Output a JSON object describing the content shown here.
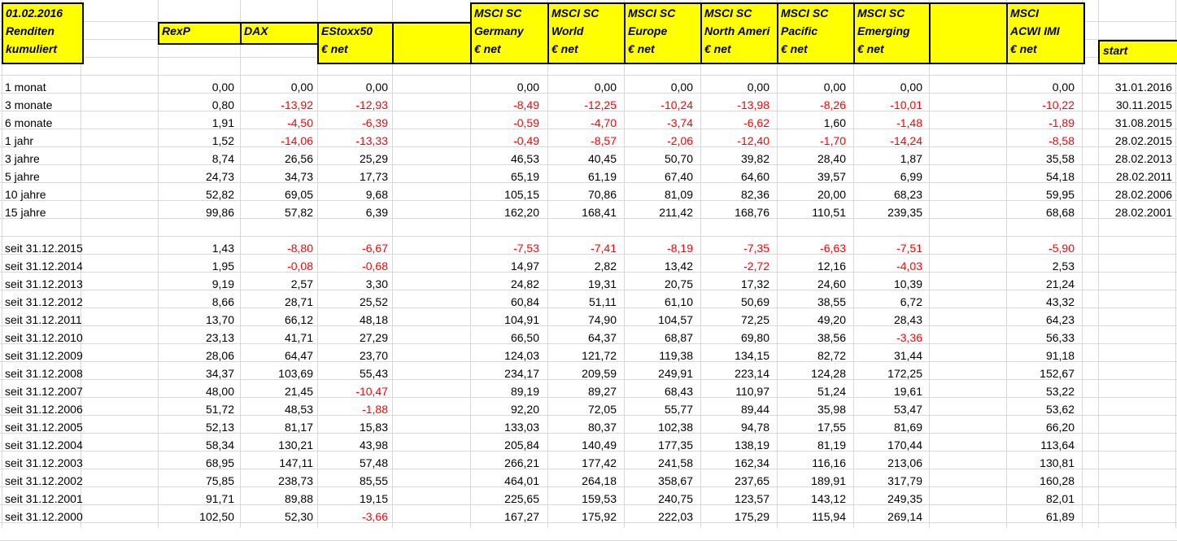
{
  "header": {
    "date": "01.02.2016",
    "renditen": "Renditen",
    "kumuliert": "kumuliert",
    "start_label": "start",
    "columns": [
      {
        "line1": "",
        "line2": "RexP",
        "line3": ""
      },
      {
        "line1": "",
        "line2": "DAX",
        "line3": ""
      },
      {
        "line1": "",
        "line2": "EStoxx50",
        "line3": "€ net"
      },
      {
        "line1": "",
        "line2": "",
        "line3": ""
      },
      {
        "line1": "MSCI SC",
        "line2": "Germany",
        "line3": "€ net"
      },
      {
        "line1": "MSCI SC",
        "line2": "World",
        "line3": "€ net"
      },
      {
        "line1": "MSCI SC",
        "line2": "Europe",
        "line3": "€ net"
      },
      {
        "line1": "MSCI SC",
        "line2": "North Ameri",
        "line3": "€ net"
      },
      {
        "line1": "MSCI SC",
        "line2": "Pacific",
        "line3": "€ net"
      },
      {
        "line1": "MSCI SC",
        "line2": "Emerging",
        "line3": "€ net"
      },
      {
        "line1": "",
        "line2": "",
        "line3": ""
      },
      {
        "line1": "MSCI",
        "line2": "ACWI IMI",
        "line3": "€ net"
      }
    ]
  },
  "periods": [
    {
      "label": "1 monat",
      "values": [
        "0,00",
        "0,00",
        "0,00",
        "0,00",
        "0,00",
        "0,00",
        "0,00",
        "0,00",
        "0,00",
        "0,00"
      ],
      "start": "31.01.2016"
    },
    {
      "label": "3 monate",
      "values": [
        "0,80",
        "-13,92",
        "-12,93",
        "-8,49",
        "-12,25",
        "-10,24",
        "-13,98",
        "-8,26",
        "-10,01",
        "-10,22"
      ],
      "start": "30.11.2015"
    },
    {
      "label": "6 monate",
      "values": [
        "1,91",
        "-4,50",
        "-6,39",
        "-0,59",
        "-4,70",
        "-3,74",
        "-6,62",
        "1,60",
        "-1,48",
        "-1,89"
      ],
      "start": "31.08.2015"
    },
    {
      "label": "1 jahr",
      "values": [
        "1,52",
        "-14,06",
        "-13,33",
        "-0,49",
        "-8,57",
        "-2,06",
        "-12,40",
        "-1,70",
        "-14,24",
        "-8,58"
      ],
      "start": "28.02.2015"
    },
    {
      "label": "3 jahre",
      "values": [
        "8,74",
        "26,56",
        "25,29",
        "46,53",
        "40,45",
        "50,70",
        "39,82",
        "28,40",
        "1,87",
        "35,58"
      ],
      "start": "28.02.2013"
    },
    {
      "label": "5 jahre",
      "values": [
        "24,73",
        "34,73",
        "17,73",
        "65,19",
        "61,19",
        "67,40",
        "64,60",
        "39,57",
        "6,99",
        "54,18"
      ],
      "start": "28.02.2011"
    },
    {
      "label": "10 jahre",
      "values": [
        "52,82",
        "69,05",
        "9,68",
        "105,15",
        "70,86",
        "81,09",
        "82,36",
        "20,00",
        "68,23",
        "59,95"
      ],
      "start": "28.02.2006"
    },
    {
      "label": "15 jahre",
      "values": [
        "99,86",
        "57,82",
        "6,39",
        "162,20",
        "168,41",
        "211,42",
        "168,76",
        "110,51",
        "239,35",
        "68,68"
      ],
      "start": "28.02.2001"
    }
  ],
  "since": [
    {
      "label": "seit 31.12.2015",
      "values": [
        "1,43",
        "-8,80",
        "-6,67",
        "-7,53",
        "-7,41",
        "-8,19",
        "-7,35",
        "-6,63",
        "-7,51",
        "-5,90"
      ]
    },
    {
      "label": "seit 31.12.2014",
      "values": [
        "1,95",
        "-0,08",
        "-0,68",
        "14,97",
        "2,82",
        "13,42",
        "-2,72",
        "12,16",
        "-4,03",
        "2,53"
      ]
    },
    {
      "label": "seit 31.12.2013",
      "values": [
        "9,19",
        "2,57",
        "3,30",
        "24,82",
        "19,31",
        "20,75",
        "17,32",
        "24,60",
        "10,39",
        "21,24"
      ]
    },
    {
      "label": "seit 31.12.2012",
      "values": [
        "8,66",
        "28,71",
        "25,52",
        "60,84",
        "51,11",
        "61,10",
        "50,69",
        "38,55",
        "6,72",
        "43,32"
      ]
    },
    {
      "label": "seit 31.12.2011",
      "values": [
        "13,70",
        "66,12",
        "48,18",
        "104,91",
        "74,90",
        "104,57",
        "72,25",
        "49,20",
        "28,43",
        "64,23"
      ]
    },
    {
      "label": "seit 31.12.2010",
      "values": [
        "23,13",
        "41,71",
        "27,29",
        "66,50",
        "64,37",
        "68,87",
        "69,80",
        "38,56",
        "-3,36",
        "56,33"
      ]
    },
    {
      "label": "seit 31.12.2009",
      "values": [
        "28,06",
        "64,47",
        "23,70",
        "124,03",
        "121,72",
        "119,38",
        "134,15",
        "82,72",
        "31,44",
        "91,18"
      ]
    },
    {
      "label": "seit 31.12.2008",
      "values": [
        "34,37",
        "103,69",
        "55,43",
        "234,17",
        "209,59",
        "249,91",
        "223,14",
        "124,28",
        "172,25",
        "152,67"
      ]
    },
    {
      "label": "seit 31.12.2007",
      "values": [
        "48,00",
        "21,45",
        "-10,47",
        "89,19",
        "89,27",
        "68,43",
        "110,97",
        "51,24",
        "19,61",
        "53,22"
      ]
    },
    {
      "label": "seit 31.12.2006",
      "values": [
        "51,72",
        "48,53",
        "-1,88",
        "92,20",
        "72,05",
        "55,77",
        "89,44",
        "35,98",
        "53,47",
        "53,62"
      ]
    },
    {
      "label": "seit 31.12.2005",
      "values": [
        "52,13",
        "81,17",
        "15,83",
        "133,03",
        "80,37",
        "102,38",
        "94,78",
        "17,55",
        "81,69",
        "66,20"
      ]
    },
    {
      "label": "seit 31.12.2004",
      "values": [
        "58,34",
        "130,21",
        "43,98",
        "205,84",
        "140,49",
        "177,35",
        "138,19",
        "81,19",
        "170,44",
        "113,64"
      ]
    },
    {
      "label": "seit 31.12.2003",
      "values": [
        "68,95",
        "147,11",
        "57,48",
        "266,21",
        "177,42",
        "241,58",
        "162,34",
        "116,16",
        "213,06",
        "130,81"
      ]
    },
    {
      "label": "seit 31.12.2002",
      "values": [
        "75,85",
        "238,73",
        "85,55",
        "464,01",
        "264,18",
        "358,67",
        "237,65",
        "189,91",
        "317,79",
        "160,28"
      ]
    },
    {
      "label": "seit 31.12.2001",
      "values": [
        "91,71",
        "89,88",
        "19,15",
        "225,65",
        "159,53",
        "240,75",
        "123,57",
        "143,12",
        "249,35",
        "82,01"
      ]
    },
    {
      "label": "seit 31.12.2000",
      "values": [
        "102,50",
        "52,30",
        "-3,66",
        "167,27",
        "175,92",
        "222,03",
        "175,29",
        "115,94",
        "269,14",
        "61,89"
      ]
    }
  ],
  "colors": {
    "header_fill": "#ffff00",
    "negative": "#ff0000",
    "gridline": "#d9d9d9"
  }
}
